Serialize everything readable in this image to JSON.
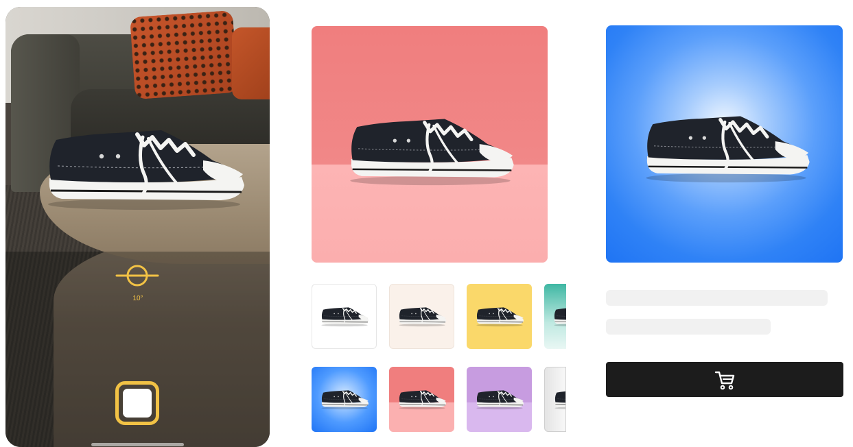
{
  "camera": {
    "level_indicator": {
      "angle_text": "10°"
    },
    "shutter": {
      "icon": "shutter-icon"
    }
  },
  "editor": {
    "preview_background": "coral",
    "colors": {
      "white": "#ffffff",
      "cream": "#faf1ea",
      "yellow": "#fad86a",
      "teal": "#3fb7a3",
      "blue": "#2f82f6",
      "red": "#f07e7e",
      "purple": "#c79ce0",
      "grey": "#e4e4e4"
    },
    "background_options": [
      {
        "name": "white"
      },
      {
        "name": "cream"
      },
      {
        "name": "yellow"
      },
      {
        "name": "teal"
      },
      {
        "name": "blue"
      },
      {
        "name": "red"
      },
      {
        "name": "purple"
      },
      {
        "name": "grey"
      }
    ]
  },
  "product": {
    "image_background": "blue-gradient",
    "cart_button": {
      "icon": "cart-icon"
    },
    "accent": "#1c1c1c"
  }
}
